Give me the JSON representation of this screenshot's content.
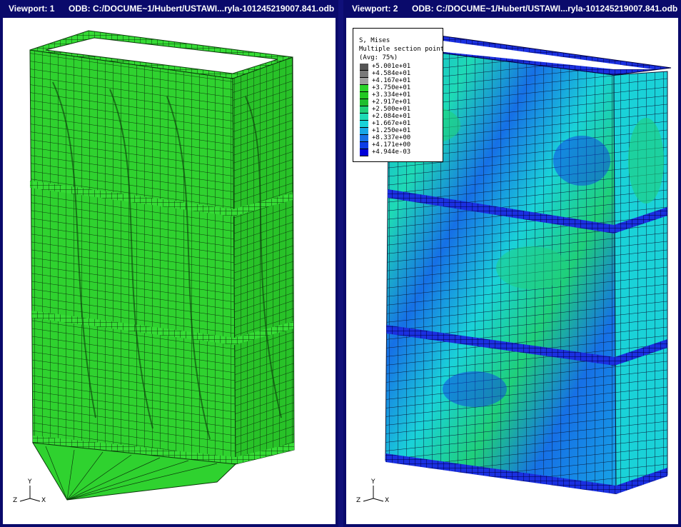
{
  "viewports": [
    {
      "label": "Viewport: 1",
      "odb": "ODB: C:/DOCUME~1/Hubert/USTAWI...ryla-101245219007.841.odb"
    },
    {
      "label": "Viewport: 2",
      "odb": "ODB: C:/DOCUME~1/Hubert/USTAWI...ryla-101245219007.841.odb"
    }
  ],
  "legend": {
    "title": "S, Mises",
    "subtitle": "Multiple section points",
    "average": "(Avg: 75%)",
    "entries": [
      {
        "value": "+5.001e+01",
        "color": "#555555"
      },
      {
        "value": "+4.584e+01",
        "color": "#7a7a7a"
      },
      {
        "value": "+4.167e+01",
        "color": "#a0a0a0"
      },
      {
        "value": "+3.750e+01",
        "color": "#2bd22b"
      },
      {
        "value": "+3.334e+01",
        "color": "#22c822"
      },
      {
        "value": "+2.917e+01",
        "color": "#1ebe2e"
      },
      {
        "value": "+2.500e+01",
        "color": "#1fd07a"
      },
      {
        "value": "+2.084e+01",
        "color": "#1edab5"
      },
      {
        "value": "+1.667e+01",
        "color": "#1ad2d8"
      },
      {
        "value": "+1.250e+01",
        "color": "#17a6e6"
      },
      {
        "value": "+8.337e+00",
        "color": "#1670e6"
      },
      {
        "value": "+4.171e+00",
        "color": "#0d3de6"
      },
      {
        "value": "+4.944e-03",
        "color": "#0000d8"
      }
    ]
  },
  "triad": {
    "y": "Y",
    "z": "Z",
    "x": "X"
  },
  "colors": {
    "frame": "#0a0a6b",
    "model_green": "#2ed12e",
    "mesh": "#0a2a0a",
    "blue": "#1670e6"
  }
}
